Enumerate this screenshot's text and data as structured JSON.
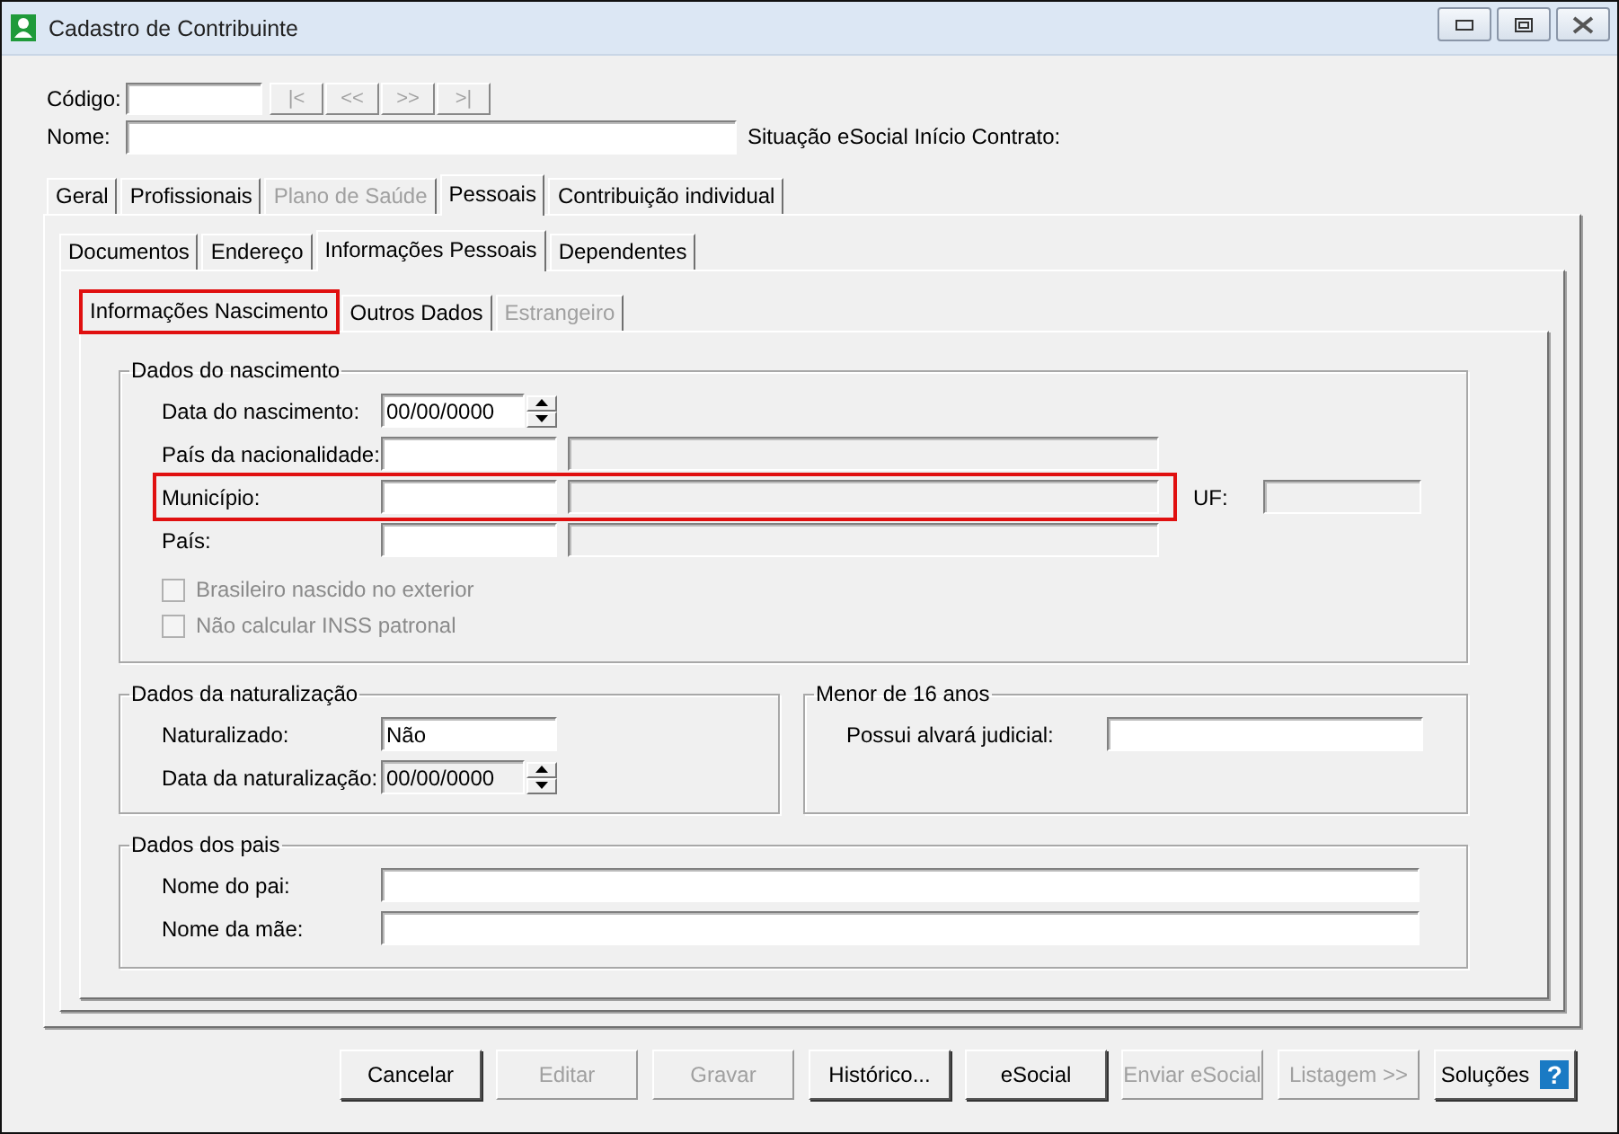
{
  "window": {
    "title": "Cadastro de Contribuinte"
  },
  "header": {
    "code_label": "Código:",
    "nav_buttons": [
      {
        "label": "|<",
        "disabled": true
      },
      {
        "label": "<<",
        "disabled": true
      },
      {
        "label": ">>",
        "disabled": true
      },
      {
        "label": ">|",
        "disabled": true
      }
    ],
    "name_label": "Nome:",
    "situation_label": "Situação eSocial Início Contrato:"
  },
  "tabs": [
    {
      "label": "Geral",
      "selected": false,
      "disabled": false
    },
    {
      "label": "Profissionais",
      "selected": false,
      "disabled": false
    },
    {
      "label": "Plano de Saúde",
      "selected": false,
      "disabled": true
    },
    {
      "label": "Pessoais",
      "selected": true,
      "disabled": false
    },
    {
      "label": "Contribuição individual",
      "selected": false,
      "disabled": false
    }
  ],
  "subtabs": [
    {
      "label": "Documentos",
      "selected": false,
      "disabled": false
    },
    {
      "label": "Endereço",
      "selected": false,
      "disabled": false
    },
    {
      "label": "Informações Pessoais",
      "selected": true,
      "disabled": false
    },
    {
      "label": "Dependentes",
      "selected": false,
      "disabled": false
    }
  ],
  "section_tabs": [
    {
      "label": "Informações Nascimento",
      "selected": true,
      "disabled": false,
      "highlighted": true
    },
    {
      "label": "Outros Dados",
      "selected": false,
      "disabled": false,
      "highlighted": false
    },
    {
      "label": "Estrangeiro",
      "selected": false,
      "disabled": true,
      "highlighted": false
    }
  ],
  "birth_group": {
    "title": "Dados do nascimento",
    "rows": [
      {
        "kind": "spin",
        "label": "Data do nascimento:",
        "value": "00/00/0000",
        "disabled": false,
        "highlighted": false
      },
      {
        "kind": "lookup",
        "label": "País da nacionalidade:",
        "highlighted": false
      },
      {
        "kind": "lookup",
        "label": "Município:",
        "highlighted": true,
        "uf_label": "UF:"
      },
      {
        "kind": "lookup",
        "label": "País:",
        "highlighted": false
      }
    ],
    "checkboxes": [
      {
        "label": "Brasileiro nascido no exterior",
        "checked": false,
        "disabled": true
      },
      {
        "label": "Não calcular INSS patronal",
        "checked": false,
        "disabled": true
      }
    ]
  },
  "naturalization_group": {
    "title": "Dados da naturalização",
    "rows": [
      {
        "kind": "text",
        "label": "Naturalizado:",
        "value": "Não"
      },
      {
        "kind": "spin",
        "label": "Data da naturalização:",
        "value": "00/00/0000",
        "disabled": true
      }
    ]
  },
  "minor_group": {
    "title": "Menor de 16 anos",
    "rows": [
      {
        "kind": "text",
        "label": "Possui alvará judicial:"
      }
    ]
  },
  "parents_group": {
    "title": "Dados dos pais",
    "rows": [
      {
        "kind": "wide",
        "label": "Nome do pai:"
      },
      {
        "kind": "wide",
        "label": "Nome da mãe:"
      }
    ]
  },
  "buttons": [
    {
      "label": "Cancelar",
      "disabled": false
    },
    {
      "label": "Editar",
      "disabled": true
    },
    {
      "label": "Gravar",
      "disabled": true
    },
    {
      "label": "Histórico...",
      "disabled": false
    },
    {
      "label": "eSocial",
      "disabled": false
    },
    {
      "label": "Enviar eSocial",
      "disabled": true
    },
    {
      "label": "Listagem >>",
      "disabled": true
    }
  ],
  "help_button": {
    "label": "Soluções",
    "glyph": "?"
  }
}
